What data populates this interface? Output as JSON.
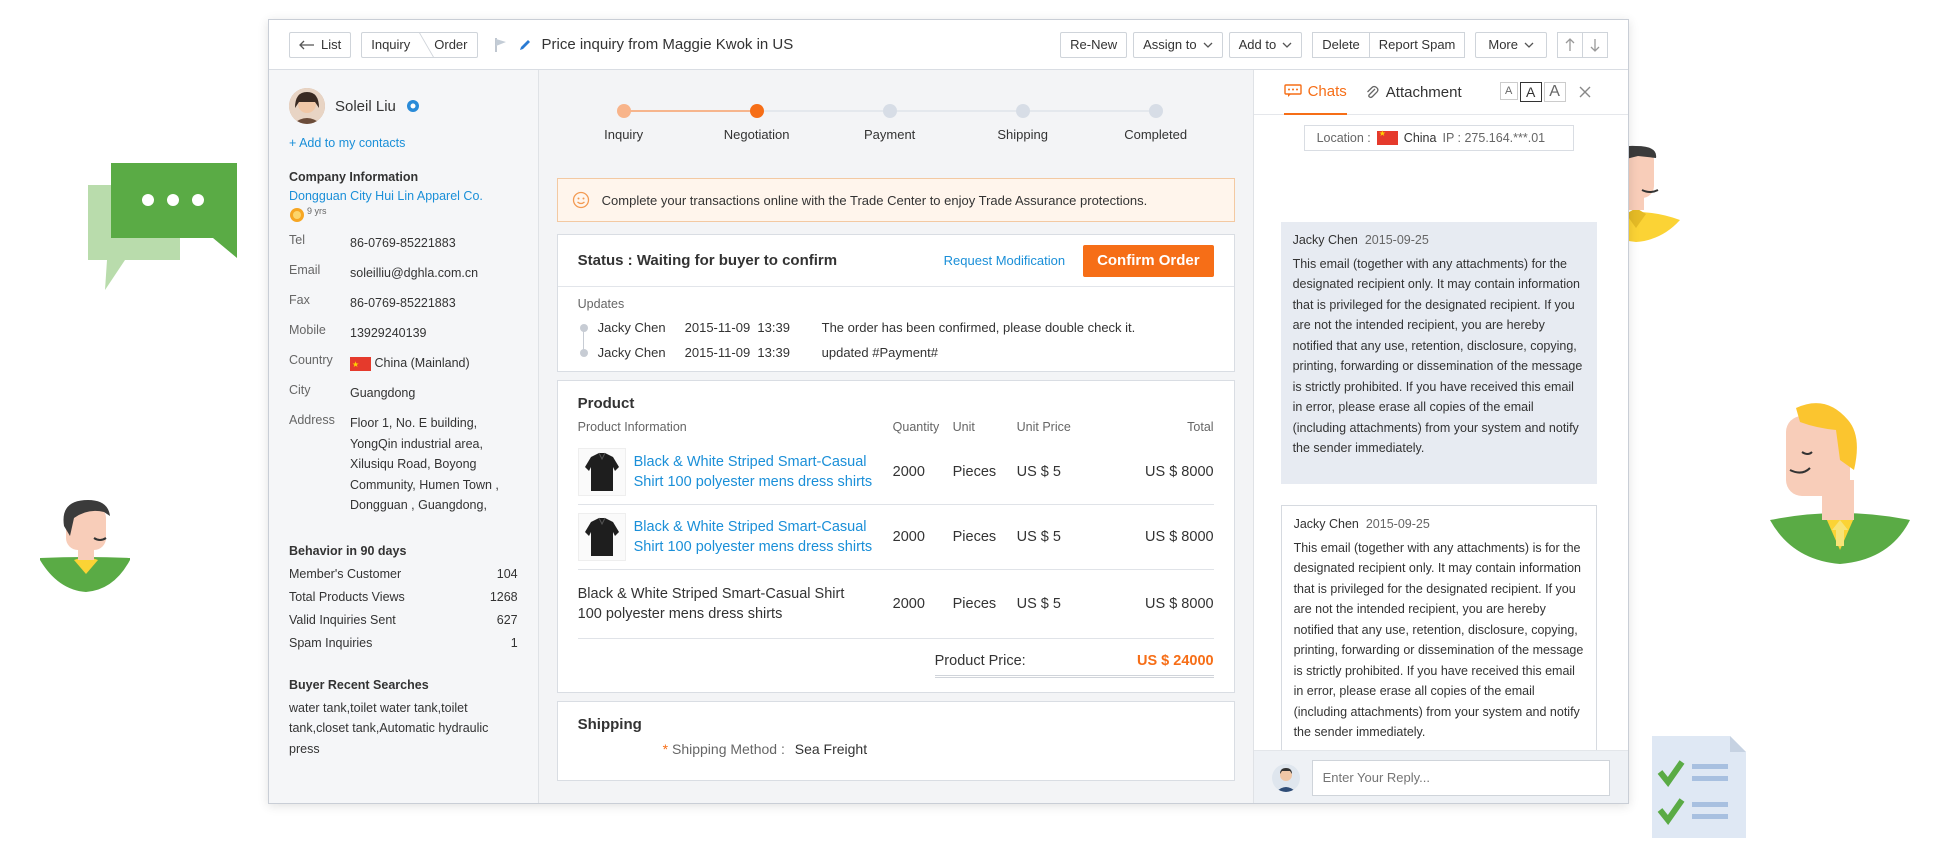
{
  "toolbar": {
    "list_label": "List",
    "breadcrumb": [
      "Inquiry",
      "Order"
    ],
    "title": "Price inquiry from Maggie Kwok in US",
    "renew_label": "Re-New",
    "assign_label": "Assign to",
    "addto_label": "Add to",
    "delete_label": "Delete",
    "spam_label": "Report Spam",
    "more_label": "More"
  },
  "contact": {
    "name": "Soleil Liu",
    "add_contact": "+ Add to my contacts",
    "company_heading": "Company Information",
    "company_name": "Dongguan City Hui Lin Apparel Co.",
    "badge_text": "9 yrs",
    "fields": [
      {
        "k": "Tel",
        "v": "86-0769-85221883"
      },
      {
        "k": "Email",
        "v": "soleilliu@dghla.com.cn"
      },
      {
        "k": "Fax",
        "v": "86-0769-85221883"
      },
      {
        "k": "Mobile",
        "v": "13929240139"
      },
      {
        "k": "Country",
        "v": "China (Mainland)"
      },
      {
        "k": "City",
        "v": "Guangdong"
      }
    ],
    "address_label": "Address",
    "address": "Floor 1, No. E building, YongQin industrial area, Xilusiqu Road, Boyong Community, Humen Town , Dongguan , Guangdong,",
    "behavior_heading": "Behavior in 90 days",
    "behavior": [
      {
        "k": "Member's Customer",
        "v": "104"
      },
      {
        "k": "Total Products Views",
        "v": "1268"
      },
      {
        "k": "Valid Inquiries Sent",
        "v": "627"
      },
      {
        "k": "Spam Inquiries",
        "v": "1"
      }
    ],
    "searches_heading": "Buyer Recent Searches",
    "searches": "water tank,toilet water tank,toilet tank,closet tank,Automatic hydraulic press"
  },
  "steps": [
    {
      "label": "Inquiry",
      "state": "done"
    },
    {
      "label": "Negotiation",
      "state": "current"
    },
    {
      "label": "Payment",
      "state": "todo"
    },
    {
      "label": "Shipping",
      "state": "todo"
    },
    {
      "label": "Completed",
      "state": "todo"
    }
  ],
  "notice": "Complete your transactions online with the Trade Center to enjoy Trade Assurance protections.",
  "status": {
    "text": "Status : Waiting for buyer to confirm",
    "request_mod": "Request Modification",
    "confirm": "Confirm Order",
    "updates_label": "Updates",
    "updates": [
      {
        "who": "Jacky Chen",
        "when": "2015-11-09  13:39",
        "msg": "The order has been confirmed, please double check it."
      },
      {
        "who": "Jacky Chen",
        "when": "2015-11-09  13:39",
        "msg": "updated #Payment#"
      }
    ]
  },
  "product": {
    "heading": "Product",
    "columns": [
      "Product Information",
      "Quantity",
      "Unit",
      "Unit Price",
      "Total"
    ],
    "rows": [
      {
        "name": "Black & White Striped Smart-Casual Shirt 100 polyester mens dress shirts",
        "qty": "2000",
        "unit": "Pieces",
        "price": "US $ 5",
        "total": "US $ 8000",
        "linked": true
      },
      {
        "name": "Black & White Striped Smart-Casual Shirt 100 polyester mens dress shirts",
        "qty": "2000",
        "unit": "Pieces",
        "price": "US $ 5",
        "total": "US $ 8000",
        "linked": true
      },
      {
        "name": "Black & White Striped Smart-Casual Shirt 100 polyester mens dress shirts",
        "qty": "2000",
        "unit": "Pieces",
        "price": "US $ 5",
        "total": "US $ 8000",
        "linked": false
      }
    ],
    "price_label": "Product Price:",
    "price_value": "US $ 24000"
  },
  "shipping": {
    "heading": "Shipping",
    "method_label": "Shipping Method :",
    "method_value": "Sea Freight"
  },
  "chat": {
    "tab_chats": "Chats",
    "tab_attachment": "Attachment",
    "font_sizes": [
      "A",
      "A",
      "A"
    ],
    "location_label": "Location :",
    "location_country": "China",
    "ip": "IP : 275.164.***.01",
    "messages": [
      {
        "who": "Jacky Chen",
        "date": "2015-09-25",
        "text": "This email (together with any attachments) for the designated recipient only. It may contain information that is privileged for the designated recipient. If you are not the intended recipient, you are hereby notified that any use, retention, disclosure, copying, printing, forwarding or dissemination of the message is strictly prohibited. If you have received this email in error, please erase all copies of the email (including attachments) from your system and notify the sender immediately."
      },
      {
        "who": "Jacky Chen",
        "date": "2015-09-25",
        "text": "This email (together with any attachments) is for the designated recipient only. It may contain information that is privileged for the designated recipient. If you are not the intended recipient, you are hereby notified that any use, retention, disclosure, copying, printing, forwarding or dissemination of the message is strictly prohibited. If you have received this email in error, please erase all copies of the email (including attachments) from your system and notify the sender immediately."
      }
    ],
    "reply_placeholder": "Enter Your Reply..."
  },
  "colors": {
    "accent": "#f66e17",
    "link": "#1a8fd8",
    "green": "#57ad43"
  }
}
